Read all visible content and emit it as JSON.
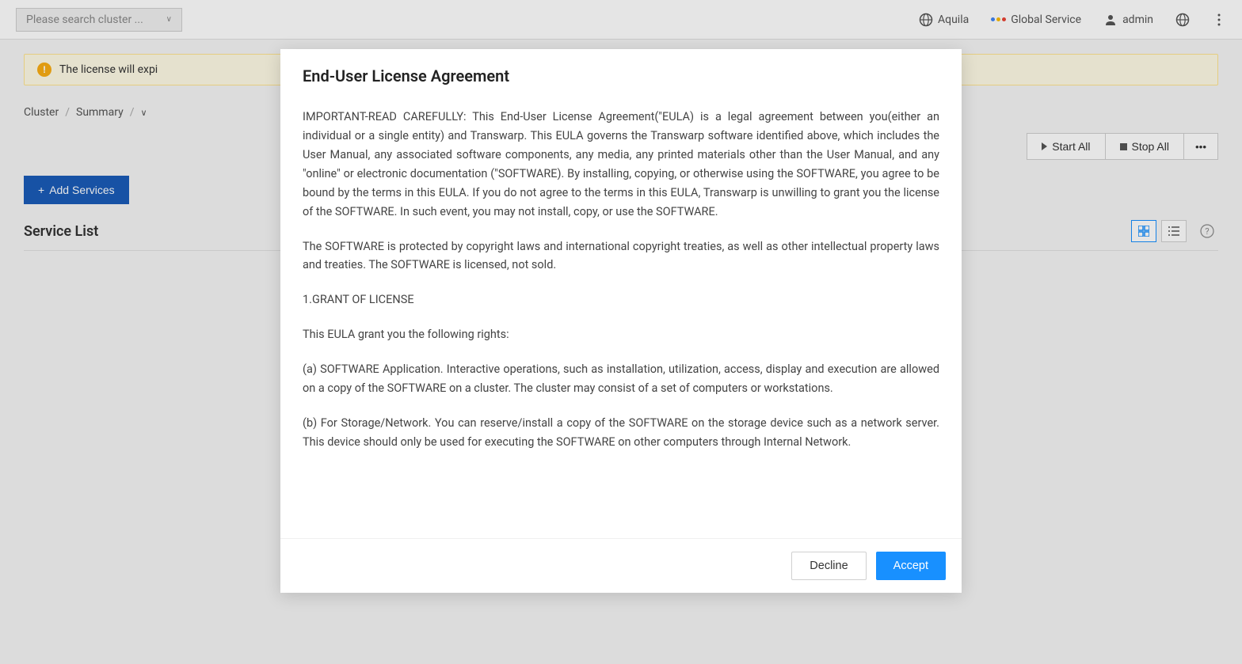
{
  "header": {
    "search_placeholder": "Please search cluster ...",
    "aquila_label": "Aquila",
    "global_service_label": "Global Service",
    "user_label": "admin"
  },
  "warning": {
    "text": "The license will expi"
  },
  "breadcrumb": {
    "cluster": "Cluster",
    "summary": "Summary"
  },
  "actions": {
    "start_all": "Start All",
    "stop_all": "Stop All",
    "add_services": "Add Services"
  },
  "service_list": {
    "title": "Service List"
  },
  "modal": {
    "title": "End-User License Agreement",
    "p1": "IMPORTANT-READ CAREFULLY: This End-User License Agreement(\"EULA) is a legal agreement between you(either an individual or a single entity) and Transwarp. This EULA governs the Transwarp software identified above, which includes the User Manual, any associated software components, any media, any printed materials other than the User Manual, and any \"online\" or electronic documentation (\"SOFTWARE). By installing, copying, or otherwise using the SOFTWARE, you agree to be bound by the terms in this EULA. If you do not agree to the terms in this EULA, Transwarp is unwilling to grant you the license of the SOFTWARE. In such event, you may not install, copy, or use the SOFTWARE.",
    "p2": "The SOFTWARE is protected by copyright laws and international copyright treaties, as well as other intellectual property laws and treaties. The SOFTWARE is licensed, not sold.",
    "p3": "1.GRANT OF LICENSE",
    "p4": "This EULA grant you the following rights:",
    "p5": "(a) SOFTWARE Application. Interactive operations, such as installation, utilization, access, display and execution are allowed on a copy of the SOFTWARE on a cluster. The cluster may consist of a set of computers or workstations.",
    "p6": "(b) For Storage/Network. You can reserve/install a copy of the SOFTWARE on the storage device such as a network server. This device should only be used for executing the SOFTWARE on other computers through Internal Network.",
    "decline_label": "Decline",
    "accept_label": "Accept"
  }
}
